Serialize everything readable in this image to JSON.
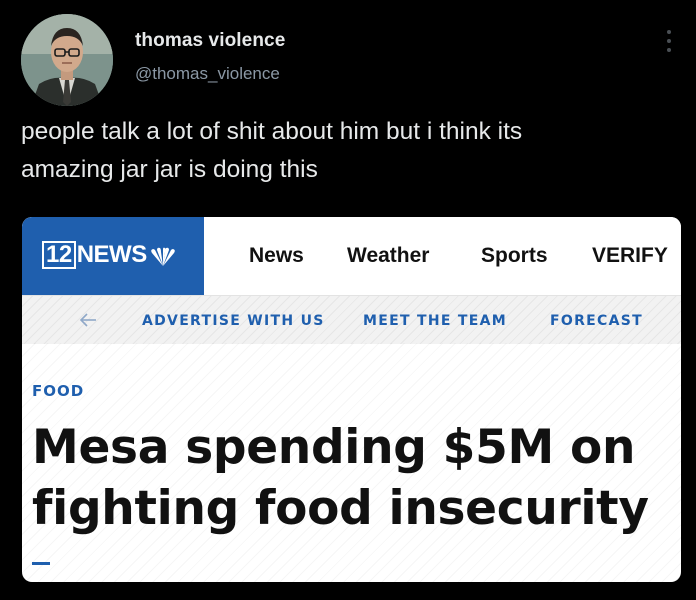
{
  "tweet": {
    "display_name": "thomas violence",
    "handle": "@thomas_violence",
    "text": "people talk a lot of shit about him but i think its\namazing jar jar is doing this",
    "avatar_icon": "avatar-photo",
    "more_icon": "more-vertical-icon"
  },
  "card": {
    "brand_color": "#1f5fae",
    "logo": {
      "number": "12",
      "word": "NEWS"
    },
    "nav": [
      "News",
      "Weather",
      "Sports",
      "VERIFY"
    ],
    "subnav": [
      "ADVERTISE WITH US",
      "MEET THE TEAM",
      "FORECAST"
    ],
    "category": "FOOD",
    "headline": "Mesa spending $5M on\nfighting food insecurity"
  },
  "colors": {
    "background": "#000000",
    "primary_text": "#e7e9ea",
    "secondary_text": "#8b98a5",
    "accent": "#1f5fae"
  }
}
